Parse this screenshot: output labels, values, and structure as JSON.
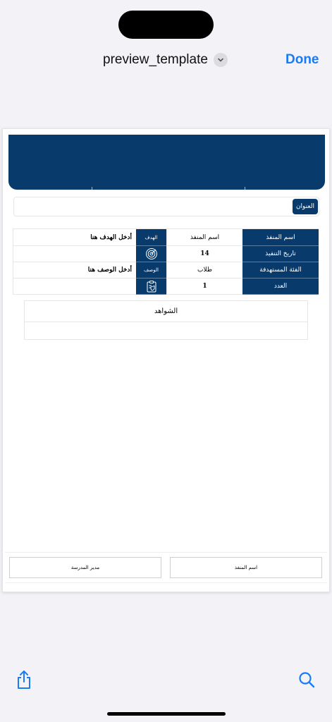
{
  "nav": {
    "title": "preview_template",
    "done_label": "Done"
  },
  "document": {
    "title_label": "العنوان",
    "rows": [
      {
        "header": "اسم المنفذ",
        "value": "اسم المنفذ"
      },
      {
        "header": "تاريخ التنفيذ",
        "value": "14"
      },
      {
        "header": "الفئة المستهدفة",
        "value": "طلاب"
      },
      {
        "header": "العدد",
        "value": "1"
      }
    ],
    "goal": {
      "label": "الهدف",
      "value": "أدخل الهدف هنا"
    },
    "description": {
      "label": "الوصف",
      "value": "أدخل الوصف هنا"
    },
    "evidence_title": "الشواهد",
    "signatures": {
      "left": "مدير المدرسة",
      "right": "اسم المنفذ"
    }
  },
  "colors": {
    "brand": "#083b6c",
    "accent": "#1a7cf4"
  },
  "icons": [
    "chevron-down-icon",
    "target-icon",
    "clipboard-icon",
    "share-icon",
    "search-icon"
  ]
}
